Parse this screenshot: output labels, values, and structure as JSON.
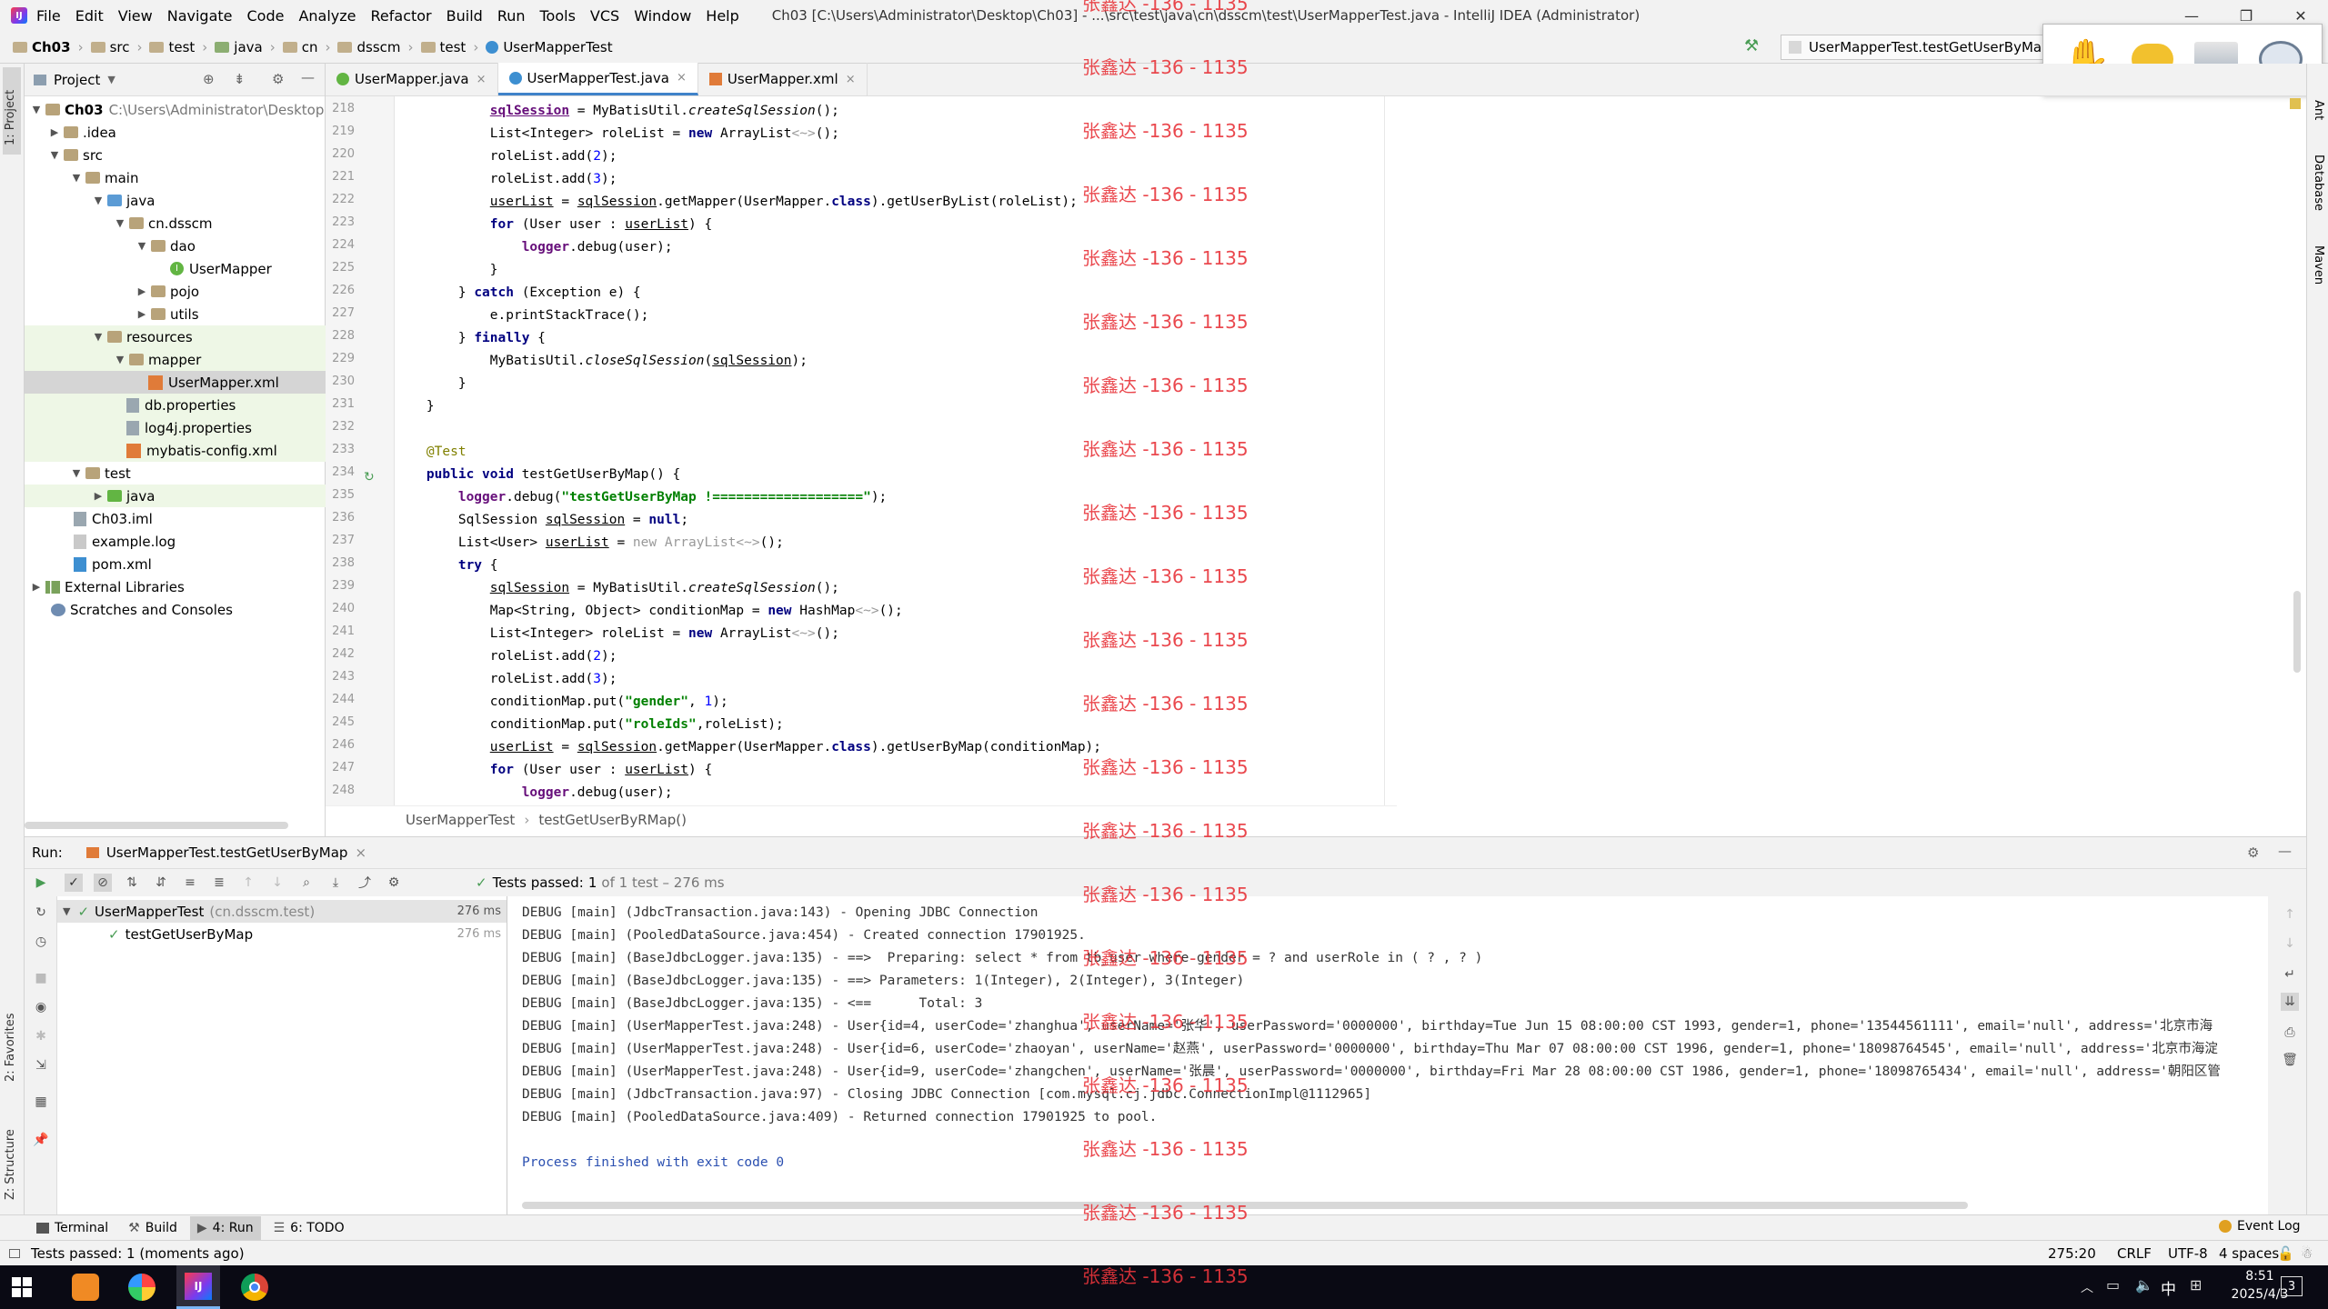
{
  "titlebar": {
    "menu": [
      "File",
      "Edit",
      "View",
      "Navigate",
      "Code",
      "Analyze",
      "Refactor",
      "Build",
      "Run",
      "Tools",
      "VCS",
      "Window",
      "Help"
    ],
    "title": "Ch03 [C:\\Users\\Administrator\\Desktop\\Ch03] - ...\\src\\test\\java\\cn\\dsscm\\test\\UserMapperTest.java - IntelliJ IDEA (Administrator)"
  },
  "navbar": {
    "crumbs": [
      "Ch03",
      "src",
      "test",
      "java",
      "cn",
      "dsscm",
      "test",
      "UserMapperTest"
    ],
    "run_config": "UserMapperTest.testGetUserByMap"
  },
  "left_strip": {
    "project_label": "1: Project",
    "favorites_label": "2: Favorites",
    "structure_label": "Z: Structure"
  },
  "right_strip": {
    "ant_label": "Ant",
    "database_label": "Database",
    "maven_label": "Maven"
  },
  "project_panel": {
    "title": "Project",
    "tree": [
      {
        "label": "Ch03",
        "extra": "C:\\Users\\Administrator\\Desktop"
      },
      {
        "label": ".idea"
      },
      {
        "label": "src"
      },
      {
        "label": "main"
      },
      {
        "label": "java"
      },
      {
        "label": "cn.dsscm"
      },
      {
        "label": "dao"
      },
      {
        "label": "UserMapper"
      },
      {
        "label": "pojo"
      },
      {
        "label": "utils"
      },
      {
        "label": "resources"
      },
      {
        "label": "mapper"
      },
      {
        "label": "UserMapper.xml"
      },
      {
        "label": "db.properties"
      },
      {
        "label": "log4j.properties"
      },
      {
        "label": "mybatis-config.xml"
      },
      {
        "label": "test"
      },
      {
        "label": "java"
      },
      {
        "label": "Ch03.iml"
      },
      {
        "label": "example.log"
      },
      {
        "label": "pom.xml"
      },
      {
        "label": "External Libraries"
      },
      {
        "label": "Scratches and Consoles"
      }
    ]
  },
  "editor": {
    "tabs": [
      "UserMapper.java",
      "UserMapperTest.java",
      "UserMapper.xml"
    ],
    "line_numbers": [
      "218",
      "219",
      "220",
      "221",
      "222",
      "223",
      "224",
      "225",
      "226",
      "227",
      "228",
      "229",
      "230",
      "231",
      "232",
      "233",
      "234",
      "235",
      "236",
      "237",
      "238",
      "239",
      "240",
      "241",
      "242",
      "243",
      "244",
      "245",
      "246",
      "247",
      "248"
    ],
    "breadcrumb": [
      "UserMapperTest",
      "testGetUserByRMap()"
    ]
  },
  "run_panel": {
    "label": "Run:",
    "config": "UserMapperTest.testGetUserByMap",
    "status": "Tests passed:",
    "status_count": "1",
    "status_detail": "of 1 test – 276 ms",
    "tree": [
      {
        "label": "UserMapperTest",
        "extra": "(cn.dsscm.test)",
        "time": "276 ms"
      },
      {
        "label": "testGetUserByMap",
        "time": "276 ms"
      }
    ],
    "console": [
      "DEBUG [main] (JdbcTransaction.java:143) - Opening JDBC Connection",
      "DEBUG [main] (PooledDataSource.java:454) - Created connection 17901925.",
      "DEBUG [main] (BaseJdbcLogger.java:135) - ==>  Preparing: select * from tb_user where gender = ? and userRole in ( ? , ? )",
      "DEBUG [main] (BaseJdbcLogger.java:135) - ==> Parameters: 1(Integer), 2(Integer), 3(Integer)",
      "DEBUG [main] (BaseJdbcLogger.java:135) - <==      Total: 3",
      "DEBUG [main] (UserMapperTest.java:248) - User{id=4, userCode='zhanghua', userName='张华', userPassword='0000000', birthday=Tue Jun 15 08:00:00 CST 1993, gender=1, phone='13544561111', email='null', address='北京市海",
      "DEBUG [main] (UserMapperTest.java:248) - User{id=6, userCode='zhaoyan', userName='赵燕', userPassword='0000000', birthday=Thu Mar 07 08:00:00 CST 1996, gender=1, phone='18098764545', email='null', address='北京市海淀",
      "DEBUG [main] (UserMapperTest.java:248) - User{id=9, userCode='zhangchen', userName='张晨', userPassword='0000000', birthday=Fri Mar 28 08:00:00 CST 1986, gender=1, phone='18098765434', email='null', address='朝阳区管",
      "DEBUG [main] (JdbcTransaction.java:97) - Closing JDBC Connection [com.mysql.cj.jdbc.ConnectionImpl@1112965]",
      "DEBUG [main] (PooledDataSource.java:409) - Returned connection 17901925 to pool.",
      "",
      "Process finished with exit code 0"
    ]
  },
  "bottom_tools": [
    "Terminal",
    "Build",
    "4: Run",
    "6: TODO"
  ],
  "event_log": "Event Log",
  "statusbar": {
    "message": "Tests passed: 1 (moments ago)",
    "position": "275:20",
    "line_sep": "CRLF",
    "encoding": "UTF-8",
    "indent": "4 spaces"
  },
  "taskbar": {
    "ime": "中",
    "time": "8:51",
    "date": "2025/4/3",
    "notif": "3"
  },
  "watermark": "张鑫达 -136 - 1135",
  "colors": {
    "accent": "#4083c9",
    "pass_green": "#499c54",
    "watermark_red": "#e8353b"
  }
}
